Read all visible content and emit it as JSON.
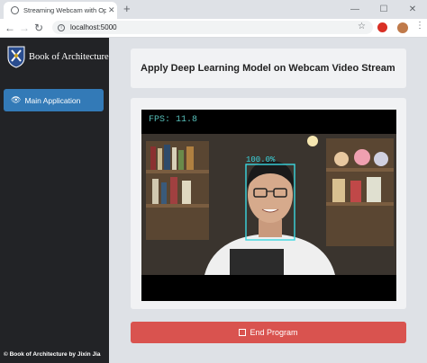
{
  "browser": {
    "tab_title": "Streaming Webcam with OpenCV",
    "url": "localhost:5000"
  },
  "sidebar": {
    "brand": "Book of Architecture",
    "nav": [
      {
        "label": "Main Application",
        "icon": "eye-icon",
        "active": true
      }
    ],
    "footer": "© Book of Architecture by Jixin Jia"
  },
  "main": {
    "heading": "Apply Deep Learning Model on Webcam Video Stream",
    "video": {
      "fps_label": "FPS: 11.8",
      "detection_label": "100.0%"
    },
    "end_button": "End Program"
  },
  "colors": {
    "accent": "#337ab7",
    "danger": "#d9534f",
    "sidebar_bg": "#222326",
    "overlay_text": "#56bfb9",
    "box": "#3ad7e0"
  }
}
